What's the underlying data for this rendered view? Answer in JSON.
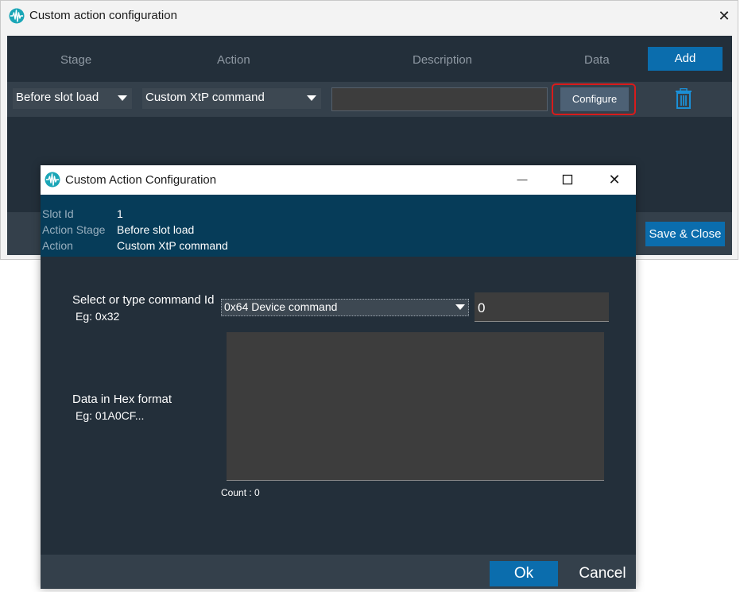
{
  "main_window": {
    "title": "Custom action configuration",
    "icon": "waveform-app-icon",
    "close_glyph": "✕",
    "columns": {
      "stage": "Stage",
      "action": "Action",
      "description": "Description",
      "data": "Data"
    },
    "add_label": "Add",
    "row": {
      "stage": "Before slot load",
      "action": "Custom XtP command",
      "description": "",
      "configure_label": "Configure",
      "delete_icon": "trash-icon"
    },
    "save_close_label": "Save & Close"
  },
  "dialog": {
    "title": "Custom Action Configuration",
    "minimize_glyph": "—",
    "close_glyph": "✕",
    "header": {
      "slot_id_label": "Slot Id",
      "slot_id_value": "1",
      "stage_label": "Action Stage",
      "stage_value": "Before slot load",
      "action_label": "Action",
      "action_value": "Custom XtP command"
    },
    "command_label": "Select or type command Id",
    "command_example": "Eg: 0x32",
    "command_selected": "0x64 Device command",
    "command_id_value": "0",
    "data_label": "Data in Hex format",
    "data_example": "Eg: 01A0CF...",
    "hex_value": "",
    "count_text": "Count : 0",
    "ok_label": "Ok",
    "cancel_label": "Cancel"
  },
  "colors": {
    "panel_dark": "#232f3a",
    "row_band": "#34404b",
    "header_blue": "#063c59",
    "accent_blue": "#0b6dad",
    "highlight_red": "#d81b1b"
  }
}
